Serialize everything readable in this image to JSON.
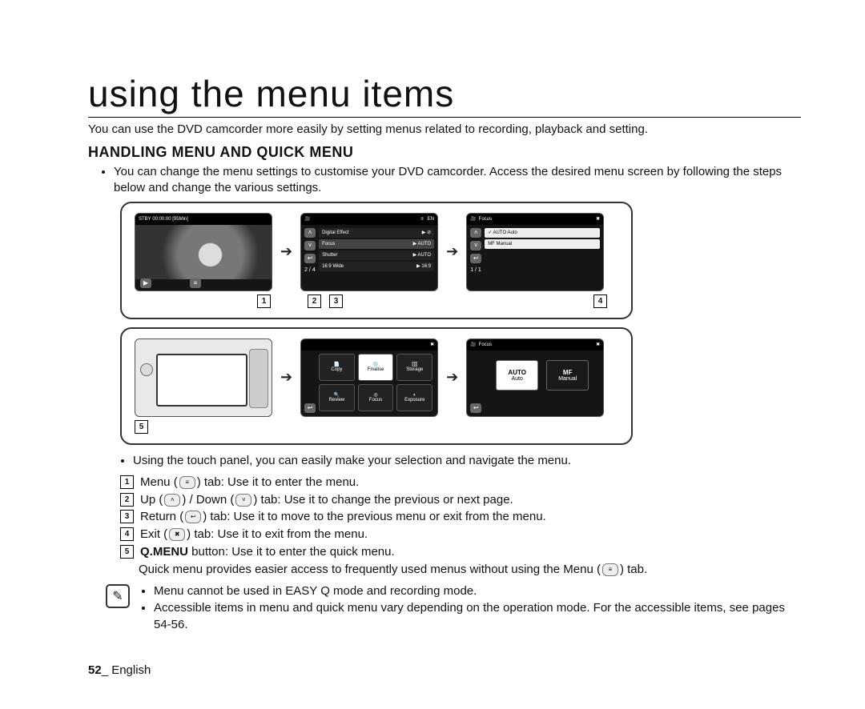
{
  "chapter": {
    "title": "using the menu items"
  },
  "intro": "You can use the DVD camcorder more easily by setting menus related to recording, playback and setting.",
  "section": {
    "title": "HANDLING MENU AND QUICK MENU"
  },
  "overview_bullet": "You can change the menu settings to customise your DVD camcorder. Access the desired menu screen by following the steps below and change the various settings.",
  "screens": {
    "row1": {
      "s1": {
        "status": "STBY  00:00:00  [95Min]"
      },
      "s2": {
        "page": "2 / 4",
        "items": [
          "Digital Effect",
          "Focus",
          "Shutter",
          "16:9 Wide"
        ]
      },
      "s3": {
        "title": "Focus",
        "page": "1 / 1",
        "items": [
          "Auto",
          "Manual"
        ]
      },
      "callouts": [
        "1",
        "2",
        "3",
        "4"
      ]
    },
    "row2": {
      "s2": {
        "items": [
          "Copy",
          "Finalise",
          "Storage",
          "Review",
          "Focus",
          "Exposure"
        ]
      },
      "s3": {
        "title": "Focus",
        "items": [
          "Auto",
          "Manual"
        ]
      },
      "callout": "5"
    }
  },
  "touch_intro": "Using the touch panel, you can easily make your selection and navigate the menu.",
  "legend": {
    "1": {
      "a": "Menu (",
      "b": ") tab: Use it to enter the menu."
    },
    "2": {
      "a": "Up (",
      "mid": ") / Down (",
      "b": ") tab: Use it to change the previous or next page."
    },
    "3": {
      "a": "Return (",
      "b": ") tab: Use it to move to the previous menu or exit from the menu."
    },
    "4": {
      "a": "Exit (",
      "b": ") tab: Use it to exit from the menu."
    },
    "5": {
      "pre": "Q.MENU",
      "a": " button: Use it to enter the quick menu."
    },
    "note": {
      "a": "Quick menu provides easier access to frequently used menus without using the Menu (",
      "b": ") tab."
    }
  },
  "notes": [
    "Menu cannot be used in EASY Q mode and recording mode.",
    "Accessible items in menu and quick menu vary depending on the operation mode. For the accessible items, see pages 54-56."
  ],
  "footer": {
    "page": "52",
    "lang": "English"
  }
}
